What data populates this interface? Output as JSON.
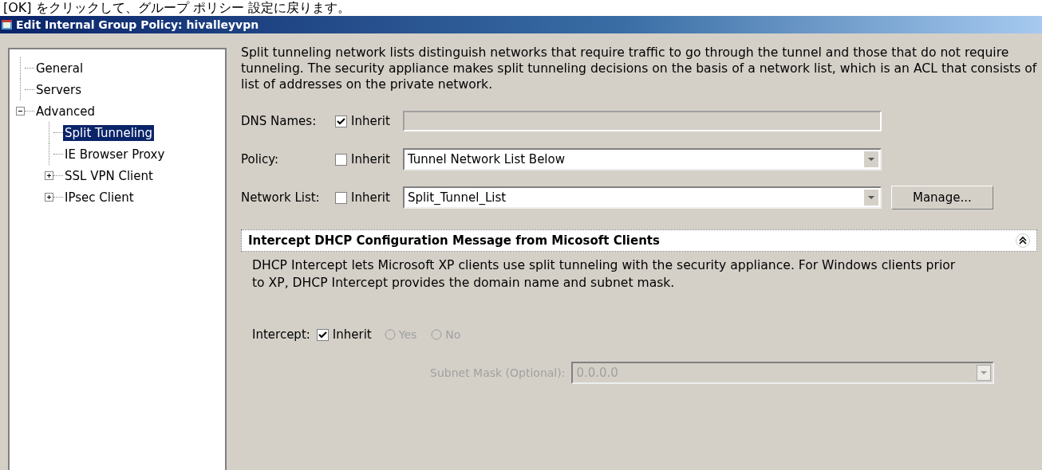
{
  "caption": "[OK] をクリックして、グループ ポリシー 設定に戻ります。",
  "window": {
    "title": "Edit Internal Group Policy: hivalleyvpn"
  },
  "tree": [
    {
      "label": "General",
      "selected": false
    },
    {
      "label": "Servers",
      "selected": false
    },
    {
      "label": "Advanced",
      "selected": false,
      "expanded": true,
      "children": [
        {
          "label": "Split Tunneling",
          "selected": true
        },
        {
          "label": "IE Browser Proxy",
          "selected": false
        },
        {
          "label": "SSL VPN Client",
          "selected": false,
          "expanded": false
        },
        {
          "label": "IPsec Client",
          "selected": false,
          "expanded": false
        }
      ]
    }
  ],
  "description": "Split tunneling network lists distinguish networks that require traffic to go through the tunnel and those that do not require tunneling. The security appliance makes split tunneling decisions on the basis of a network list, which is an ACL that consists of list of addresses on the private network.",
  "fields": [
    {
      "label": "DNS Names:",
      "inherit_label": "Inherit",
      "inherit": true,
      "kind": "text",
      "disabled": true
    },
    {
      "label": "Policy:",
      "inherit_label": "Inherit",
      "inherit": false,
      "kind": "select",
      "value": "Tunnel Network List Below",
      "disabled": false
    },
    {
      "label": "Network List:",
      "inherit_label": "Inherit",
      "inherit": false,
      "kind": "select",
      "value": "Split_Tunnel_List",
      "disabled": false,
      "button": "Manage..."
    }
  ],
  "section": {
    "title": "Intercept DHCP Configuration Message from Micosoft Clients",
    "expanded": true,
    "description": "DHCP Intercept lets Microsoft XP clients use split tunneling with the security appliance. For Windows clients prior to XP, DHCP Intercept provides the domain name and subnet mask.",
    "intercept": {
      "label": "Intercept:",
      "inherit_label": "Inherit",
      "inherit": true,
      "options": [
        {
          "label": "Yes",
          "selected": false,
          "disabled": true
        },
        {
          "label": "No",
          "selected": false,
          "disabled": true
        }
      ]
    },
    "subnet": {
      "label": "Subnet Mask (Optional):",
      "value": "0.0.0.0",
      "disabled": true
    }
  }
}
